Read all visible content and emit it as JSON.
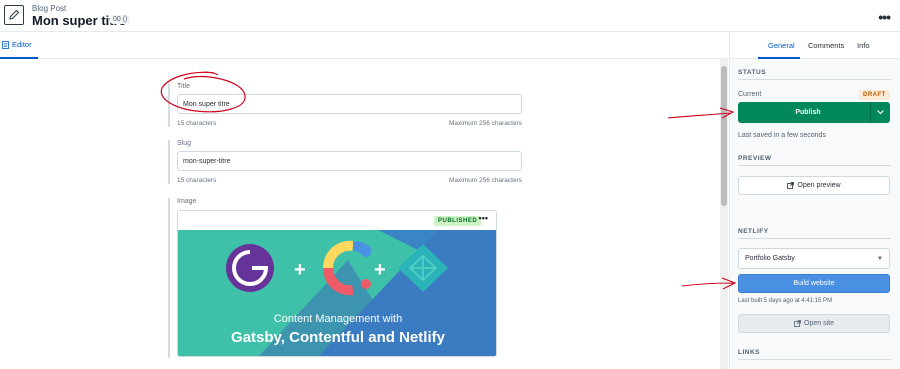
{
  "header": {
    "content_type": "Blog Post",
    "title": "Mon super titre",
    "locale_badge": "00 ()",
    "more_label": "•••"
  },
  "editor_tabs": {
    "editor_label": "Editor"
  },
  "fields": {
    "title": {
      "label": "Title",
      "value": "Mon super titre",
      "count": "15 characters",
      "max": "Maximum 256 characters"
    },
    "slug": {
      "label": "Slug",
      "value": "mon-super-titre",
      "count": "15 characters",
      "max": "Maximum 256 characters"
    },
    "image": {
      "label": "Image",
      "status": "PUBLISHED",
      "more_label": "•••",
      "image_line1": "Content Management with",
      "image_line2": "Gatsby, Contentful and Netlify"
    }
  },
  "sidebar": {
    "tabs": [
      "General",
      "Comments",
      "Info"
    ],
    "status": {
      "heading": "STATUS",
      "current_label": "Current",
      "badge": "DRAFT",
      "publish_label": "Publish",
      "last_saved": "Last saved in a few seconds"
    },
    "preview": {
      "heading": "PREVIEW",
      "open_preview_label": "Open preview"
    },
    "netlify": {
      "heading": "NETLIFY",
      "site_selected": "Portfolio Gatsby",
      "build_label": "Build website",
      "last_built": "Last built 5 days ago at 4:41:15 PM",
      "open_site_label": "Open site"
    },
    "links": {
      "heading": "LINKS"
    }
  },
  "colors": {
    "accent": "#0059c8",
    "publish_green": "#00875a",
    "build_blue": "#4a90e2",
    "annotation_red": "#d0021b"
  }
}
